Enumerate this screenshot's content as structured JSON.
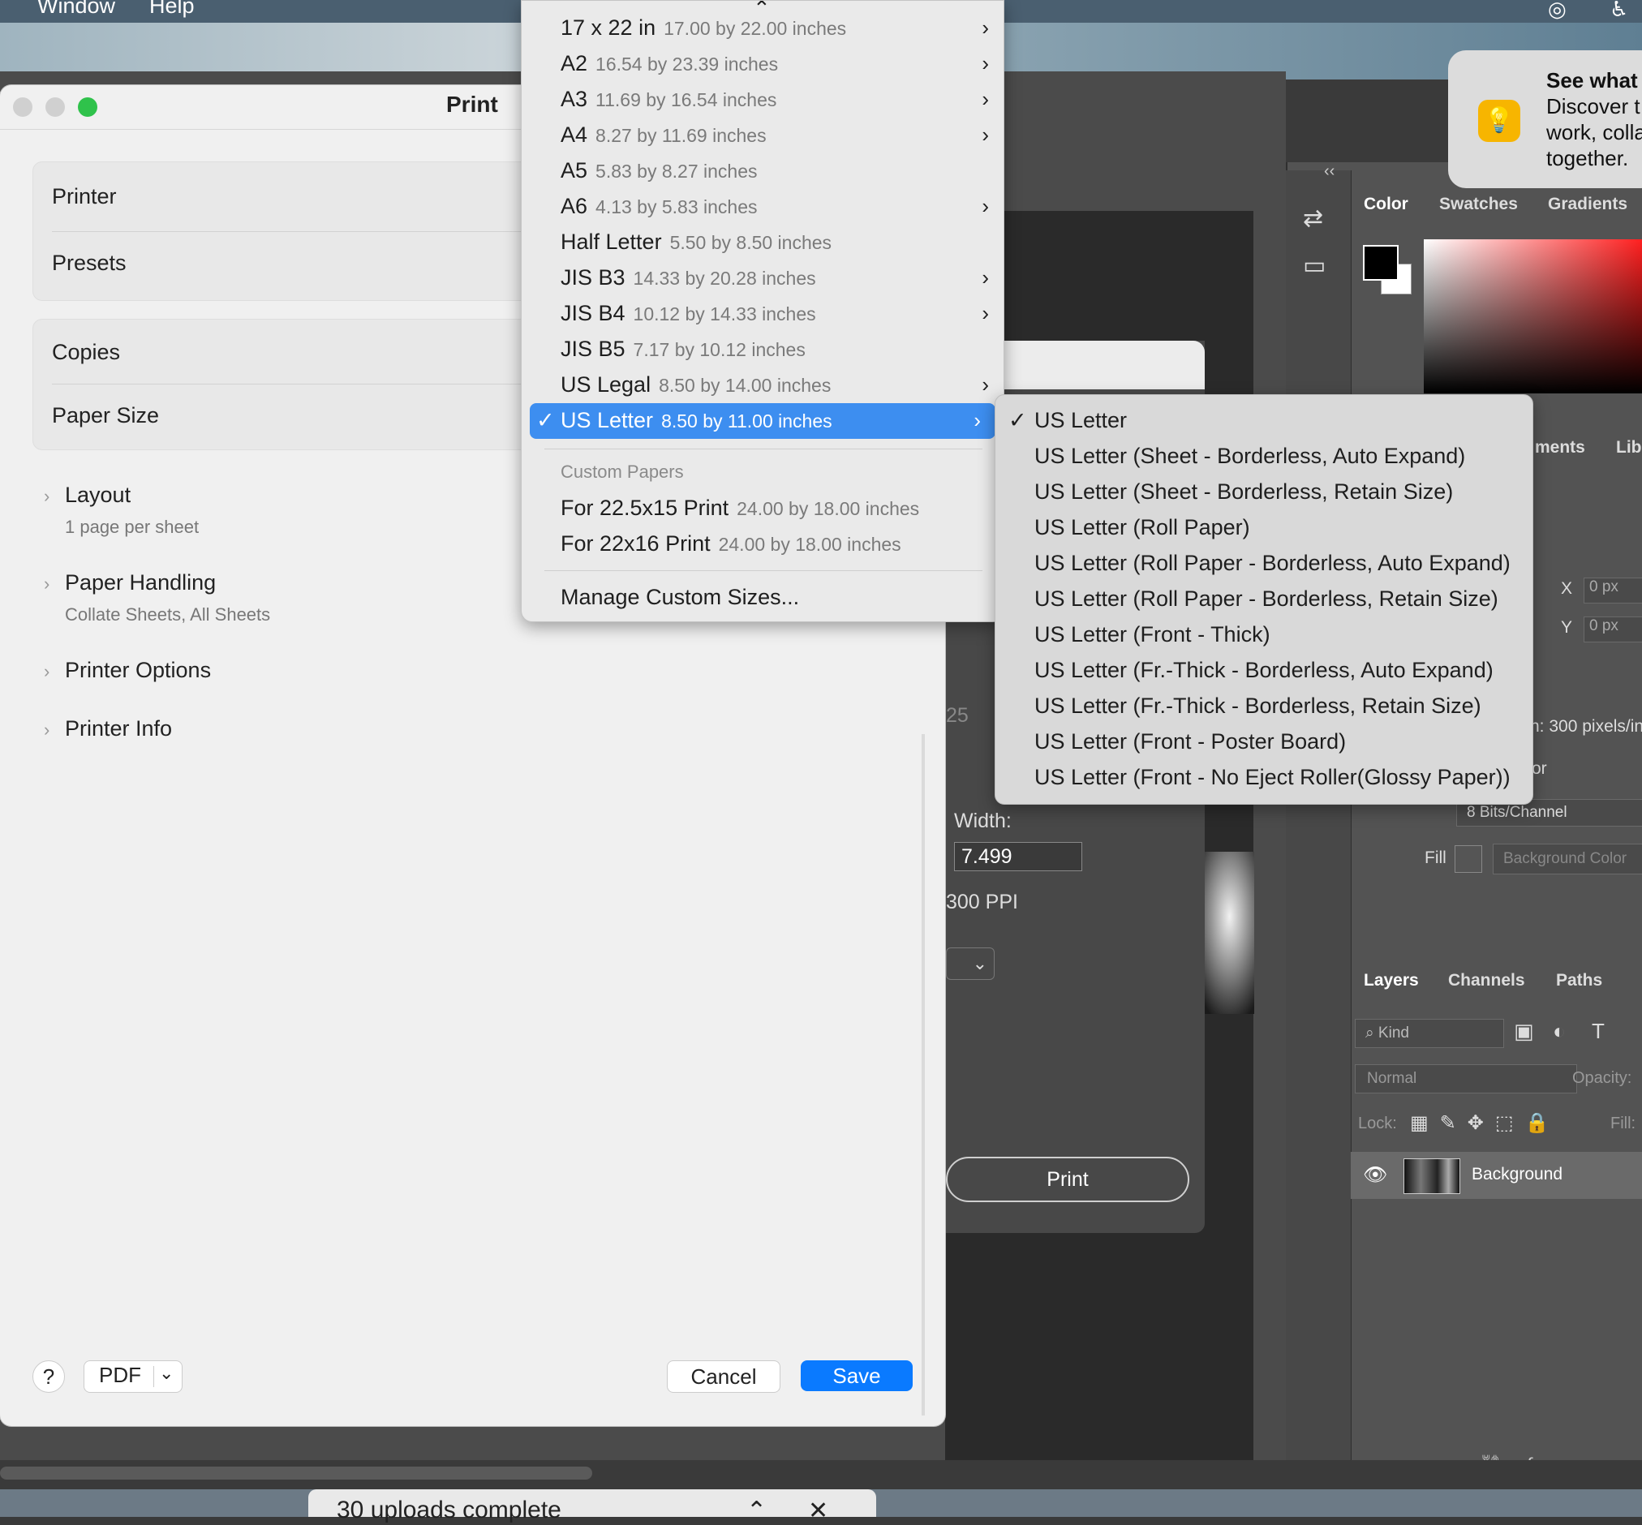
{
  "menubar": {
    "items": [
      "Window",
      "Help"
    ]
  },
  "print_dialog": {
    "title": "Print",
    "groups": {
      "printer_label": "Printer",
      "presets_label": "Presets",
      "copies_label": "Copies",
      "paper_size_label": "Paper Size"
    },
    "sections": [
      {
        "title": "Layout",
        "subtitle": "1 page per sheet"
      },
      {
        "title": "Paper Handling",
        "subtitle": "Collate Sheets, All Sheets"
      },
      {
        "title": "Printer Options",
        "subtitle": ""
      },
      {
        "title": "Printer Info",
        "subtitle": ""
      }
    ],
    "help_label": "?",
    "pdf_label": "PDF",
    "cancel_label": "Cancel",
    "save_label": "Save"
  },
  "paper_menu": {
    "scroll_up_glyph": "⌃",
    "items": [
      {
        "name": "17 x 22 in",
        "dims": "17.00 by 22.00 inches",
        "submenu": true
      },
      {
        "name": "A2",
        "dims": "16.54 by 23.39 inches",
        "submenu": true
      },
      {
        "name": "A3",
        "dims": "11.69 by 16.54 inches",
        "submenu": true
      },
      {
        "name": "A4",
        "dims": "8.27 by 11.69 inches",
        "submenu": true
      },
      {
        "name": "A5",
        "dims": "5.83 by 8.27 inches",
        "submenu": false
      },
      {
        "name": "A6",
        "dims": "4.13 by 5.83 inches",
        "submenu": true
      },
      {
        "name": "Half Letter",
        "dims": "5.50 by 8.50 inches",
        "submenu": false
      },
      {
        "name": "JIS B3",
        "dims": "14.33 by 20.28 inches",
        "submenu": true
      },
      {
        "name": "JIS B4",
        "dims": "10.12 by 14.33 inches",
        "submenu": true
      },
      {
        "name": "JIS B5",
        "dims": "7.17 by 10.12 inches",
        "submenu": false
      },
      {
        "name": "US Legal",
        "dims": "8.50 by 14.00 inches",
        "submenu": true
      },
      {
        "name": "US Letter",
        "dims": "8.50 by 11.00 inches",
        "submenu": true,
        "selected": true
      }
    ],
    "custom_section_label": "Custom Papers",
    "custom_items": [
      {
        "name": "For 22.5x15 Print",
        "dims": "24.00 by 18.00 inches"
      },
      {
        "name": "For 22x16 Print",
        "dims": "24.00 by 18.00 inches"
      }
    ],
    "manage_label": "Manage Custom Sizes..."
  },
  "sub_menu": {
    "items": [
      {
        "name": "US Letter",
        "checked": true
      },
      {
        "name": "US Letter (Sheet - Borderless, Auto Expand)"
      },
      {
        "name": "US Letter (Sheet - Borderless, Retain Size)"
      },
      {
        "name": "US Letter (Roll Paper)"
      },
      {
        "name": "US Letter (Roll Paper - Borderless, Auto Expand)"
      },
      {
        "name": "US Letter (Roll Paper - Borderless, Retain Size)"
      },
      {
        "name": "US Letter (Front - Thick)"
      },
      {
        "name": "US Letter (Fr.-Thick - Borderless, Auto Expand)"
      },
      {
        "name": "US Letter (Fr.-Thick - Borderless, Retain Size)"
      },
      {
        "name": "US Letter (Front - Poster Board)"
      },
      {
        "name": "US Letter (Front - No Eject Roller(Glossy Paper))"
      }
    ]
  },
  "notification": {
    "lines": [
      "See what",
      "Discover t",
      "work, colla",
      "together."
    ]
  },
  "ps_dialog": {
    "width_label": "Width:",
    "width_value": "7.499",
    "ppi_label": "300 PPI",
    "partial_value": "25",
    "print_label": "Print"
  },
  "ps_panels": {
    "color_tabs": [
      "Color",
      "Swatches",
      "Gradients"
    ],
    "mid_tabs": [
      "ments",
      "Lib"
    ],
    "x_label": "X",
    "y_label": "Y",
    "x_value": "0 px",
    "y_value": "0 px",
    "resolution_text": "n: 300 pixels/in",
    "color_mode_partial": "or",
    "bits_label": "8 Bits/Channel",
    "fill_label": "Fill",
    "fill_value": "Background Color",
    "layer_tabs": [
      "Layers",
      "Channels",
      "Paths"
    ],
    "kind_label": "Kind",
    "blend_mode": "Normal",
    "opacity_label": "Opacity:",
    "lock_label": "Lock:",
    "fill_short_label": "Fill:",
    "layer_name": "Background"
  },
  "status": {
    "text": "30 uploads complete"
  }
}
